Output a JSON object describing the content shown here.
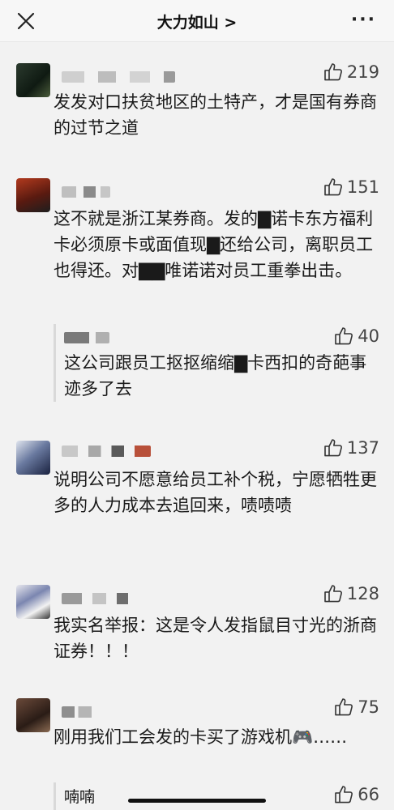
{
  "header": {
    "title": "大力如山 >",
    "close_icon": "close-icon",
    "more_label": "···"
  },
  "comments": [
    {
      "likes": "219",
      "text": "发发对口扶贫地区的土特产，才是国有券商的过节之道"
    },
    {
      "likes": "151",
      "text": "这不就是浙江某券商。发的▇诺卡东方福利卡必须原卡或面值现▇还给公司，离职员工也得还。对▇▇唯诺诺对员工重拳出击。",
      "reply": {
        "likes": "40",
        "text": "这公司跟员工抠抠缩缩▇卡西扣的奇葩事迹多了去"
      }
    },
    {
      "likes": "137",
      "text": "说明公司不愿意给员工补个税，宁愿牺牲更多的人力成本去追回来，啧啧啧"
    },
    {
      "likes": "128",
      "text": "我实名举报：这是令人发指鼠目寸光的浙商证券！！！"
    },
    {
      "likes": "75",
      "text": "刚用我们工会发的卡买了游戏机🎮……",
      "reply": {
        "likes": "66",
        "text": "喃喃"
      }
    }
  ]
}
